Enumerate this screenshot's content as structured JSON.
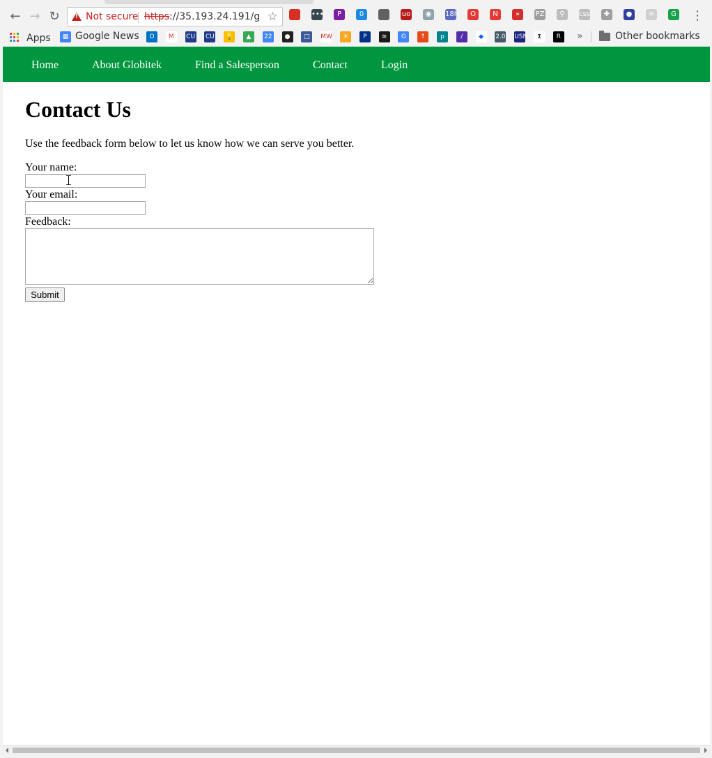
{
  "browser": {
    "back_icon": "←",
    "forward_icon": "→",
    "reload_icon": "↻",
    "security_label": "Not secure",
    "url_scheme": "https",
    "url_rest": "://35.193.24.191/g...",
    "star_icon": "☆",
    "menu_icon": "⋮",
    "extensions": [
      {
        "name": "ext-red-book-icon",
        "color": "#d93025",
        "glyph": ""
      },
      {
        "name": "ext-dots-icon",
        "color": "#37474f",
        "glyph": "•••"
      },
      {
        "name": "ext-p-icon",
        "color": "#7b1fa2",
        "glyph": "P"
      },
      {
        "name": "ext-ghost-icon",
        "color": "#1e88e5",
        "glyph": "0"
      },
      {
        "name": "ext-plug-icon",
        "color": "#616161",
        "glyph": ""
      },
      {
        "name": "ext-ublock-icon",
        "color": "#b71c1c",
        "glyph": "uo"
      },
      {
        "name": "ext-eye-icon",
        "color": "#90a4ae",
        "glyph": "◉"
      },
      {
        "name": "ext-calendar-icon",
        "color": "#5c6bc0",
        "glyph": "18h"
      },
      {
        "name": "ext-shield-icon",
        "color": "#e53935",
        "glyph": "O"
      },
      {
        "name": "ext-stop-icon",
        "color": "#e53935",
        "glyph": "N"
      },
      {
        "name": "ext-forward-icon",
        "color": "#d32f2f",
        "glyph": "»"
      },
      {
        "name": "ext-pz-icon",
        "color": "#9e9e9e",
        "glyph": "PZ"
      },
      {
        "name": "ext-magnify-icon",
        "color": "#bdbdbd",
        "glyph": "⚲"
      },
      {
        "name": "ext-css-icon",
        "color": "#bdbdbd",
        "glyph": "css"
      },
      {
        "name": "ext-gamepad-icon",
        "color": "#9e9e9e",
        "glyph": "✚"
      },
      {
        "name": "ext-flag-icon",
        "color": "#303f9f",
        "glyph": "●"
      },
      {
        "name": "ext-page-icon",
        "color": "#cfcfcf",
        "glyph": "≡"
      },
      {
        "name": "ext-grammarly-icon",
        "color": "#15a34a",
        "glyph": "G"
      }
    ]
  },
  "bookmarks": {
    "apps_label": "Apps",
    "google_news_label": "Google News",
    "more_icon": "»",
    "other_label": "Other bookmarks",
    "icons": [
      {
        "name": "outlook-bookmark-icon",
        "color": "#0072c6",
        "glyph": "O"
      },
      {
        "name": "gmail-bookmark-icon",
        "color": "#ffffff",
        "glyph": "M",
        "fg": "#d93025"
      },
      {
        "name": "cuny-bookmark-icon",
        "color": "#1e3a8a",
        "glyph": "CU"
      },
      {
        "name": "cuny2-bookmark-icon",
        "color": "#1e3a8a",
        "glyph": "CU"
      },
      {
        "name": "keep-bookmark-icon",
        "color": "#fbbc04",
        "glyph": "💡"
      },
      {
        "name": "drive-bookmark-icon",
        "color": "#34a853",
        "glyph": "▲"
      },
      {
        "name": "calendar-bookmark-icon",
        "color": "#4285f4",
        "glyph": "22"
      },
      {
        "name": "github-bookmark-icon",
        "color": "#222222",
        "glyph": "●"
      },
      {
        "name": "pocket-bookmark-icon",
        "color": "#3b5998",
        "glyph": "□"
      },
      {
        "name": "mw-bookmark-icon",
        "color": "#ffffff",
        "glyph": "MW",
        "fg": "#c62828"
      },
      {
        "name": "sun-bookmark-icon",
        "color": "#f9a825",
        "glyph": "☀"
      },
      {
        "name": "paypal-bookmark-icon",
        "color": "#003087",
        "glyph": "P"
      },
      {
        "name": "spotify-bookmark-icon",
        "color": "#1a1a1a",
        "glyph": "≋"
      },
      {
        "name": "translate-bookmark-icon",
        "color": "#4285f4",
        "glyph": "G"
      },
      {
        "name": "arrow-bookmark-icon",
        "color": "#e64a19",
        "glyph": "↑"
      },
      {
        "name": "p-bookmark-icon",
        "color": "#00838f",
        "glyph": "p"
      },
      {
        "name": "purple-bookmark-icon",
        "color": "#512da8",
        "glyph": "/"
      },
      {
        "name": "dropbox-bookmark-icon",
        "color": "#ffffff",
        "glyph": "◆",
        "fg": "#0061ff"
      },
      {
        "name": "calc-bookmark-icon",
        "color": "#455a64",
        "glyph": "2.0"
      },
      {
        "name": "usn-bookmark-icon",
        "color": "#1a237e",
        "glyph": "USN"
      },
      {
        "name": "nyt-bookmark-icon",
        "color": "#ffffff",
        "glyph": "𝕿",
        "fg": "#000"
      },
      {
        "name": "r-bookmark-icon",
        "color": "#000000",
        "glyph": "R"
      }
    ]
  },
  "site": {
    "nav": [
      "Home",
      "About Globitek",
      "Find a Salesperson",
      "Contact",
      "Login"
    ],
    "heading": "Contact Us",
    "intro": "Use the feedback form below to let us know how we can serve you better.",
    "form": {
      "name_label": "Your name:",
      "name_value": "",
      "email_label": "Your email:",
      "email_value": "",
      "feedback_label": "Feedback:",
      "feedback_value": "",
      "submit_label": "Submit"
    },
    "brand_color": "#00963f"
  }
}
